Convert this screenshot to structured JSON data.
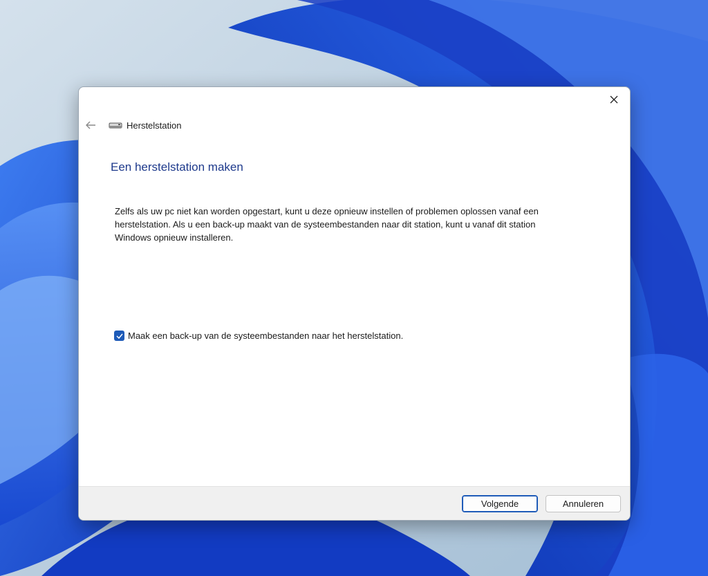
{
  "window": {
    "title": "Herstelstation"
  },
  "content": {
    "heading": "Een herstelstation maken",
    "description": "Zelfs als uw pc niet kan worden opgestart, kunt u deze opnieuw instellen of problemen oplossen vanaf een herstelstation. Als u een back-up maakt van de systeembestanden naar dit station, kunt u vanaf dit station Windows opnieuw installeren."
  },
  "checkbox": {
    "label": "Maak een back-up van de systeembestanden naar het herstelstation.",
    "checked": true
  },
  "buttons": {
    "next_label": "Volgende",
    "cancel_label": "Annuleren"
  },
  "icons": {
    "back": "arrow-left-icon",
    "close": "close-icon",
    "drive": "drive-icon",
    "check": "checkmark-icon"
  },
  "colors": {
    "accent": "#1e5bb8",
    "heading": "#1e3a8c",
    "footer": "#f0f0f0"
  }
}
